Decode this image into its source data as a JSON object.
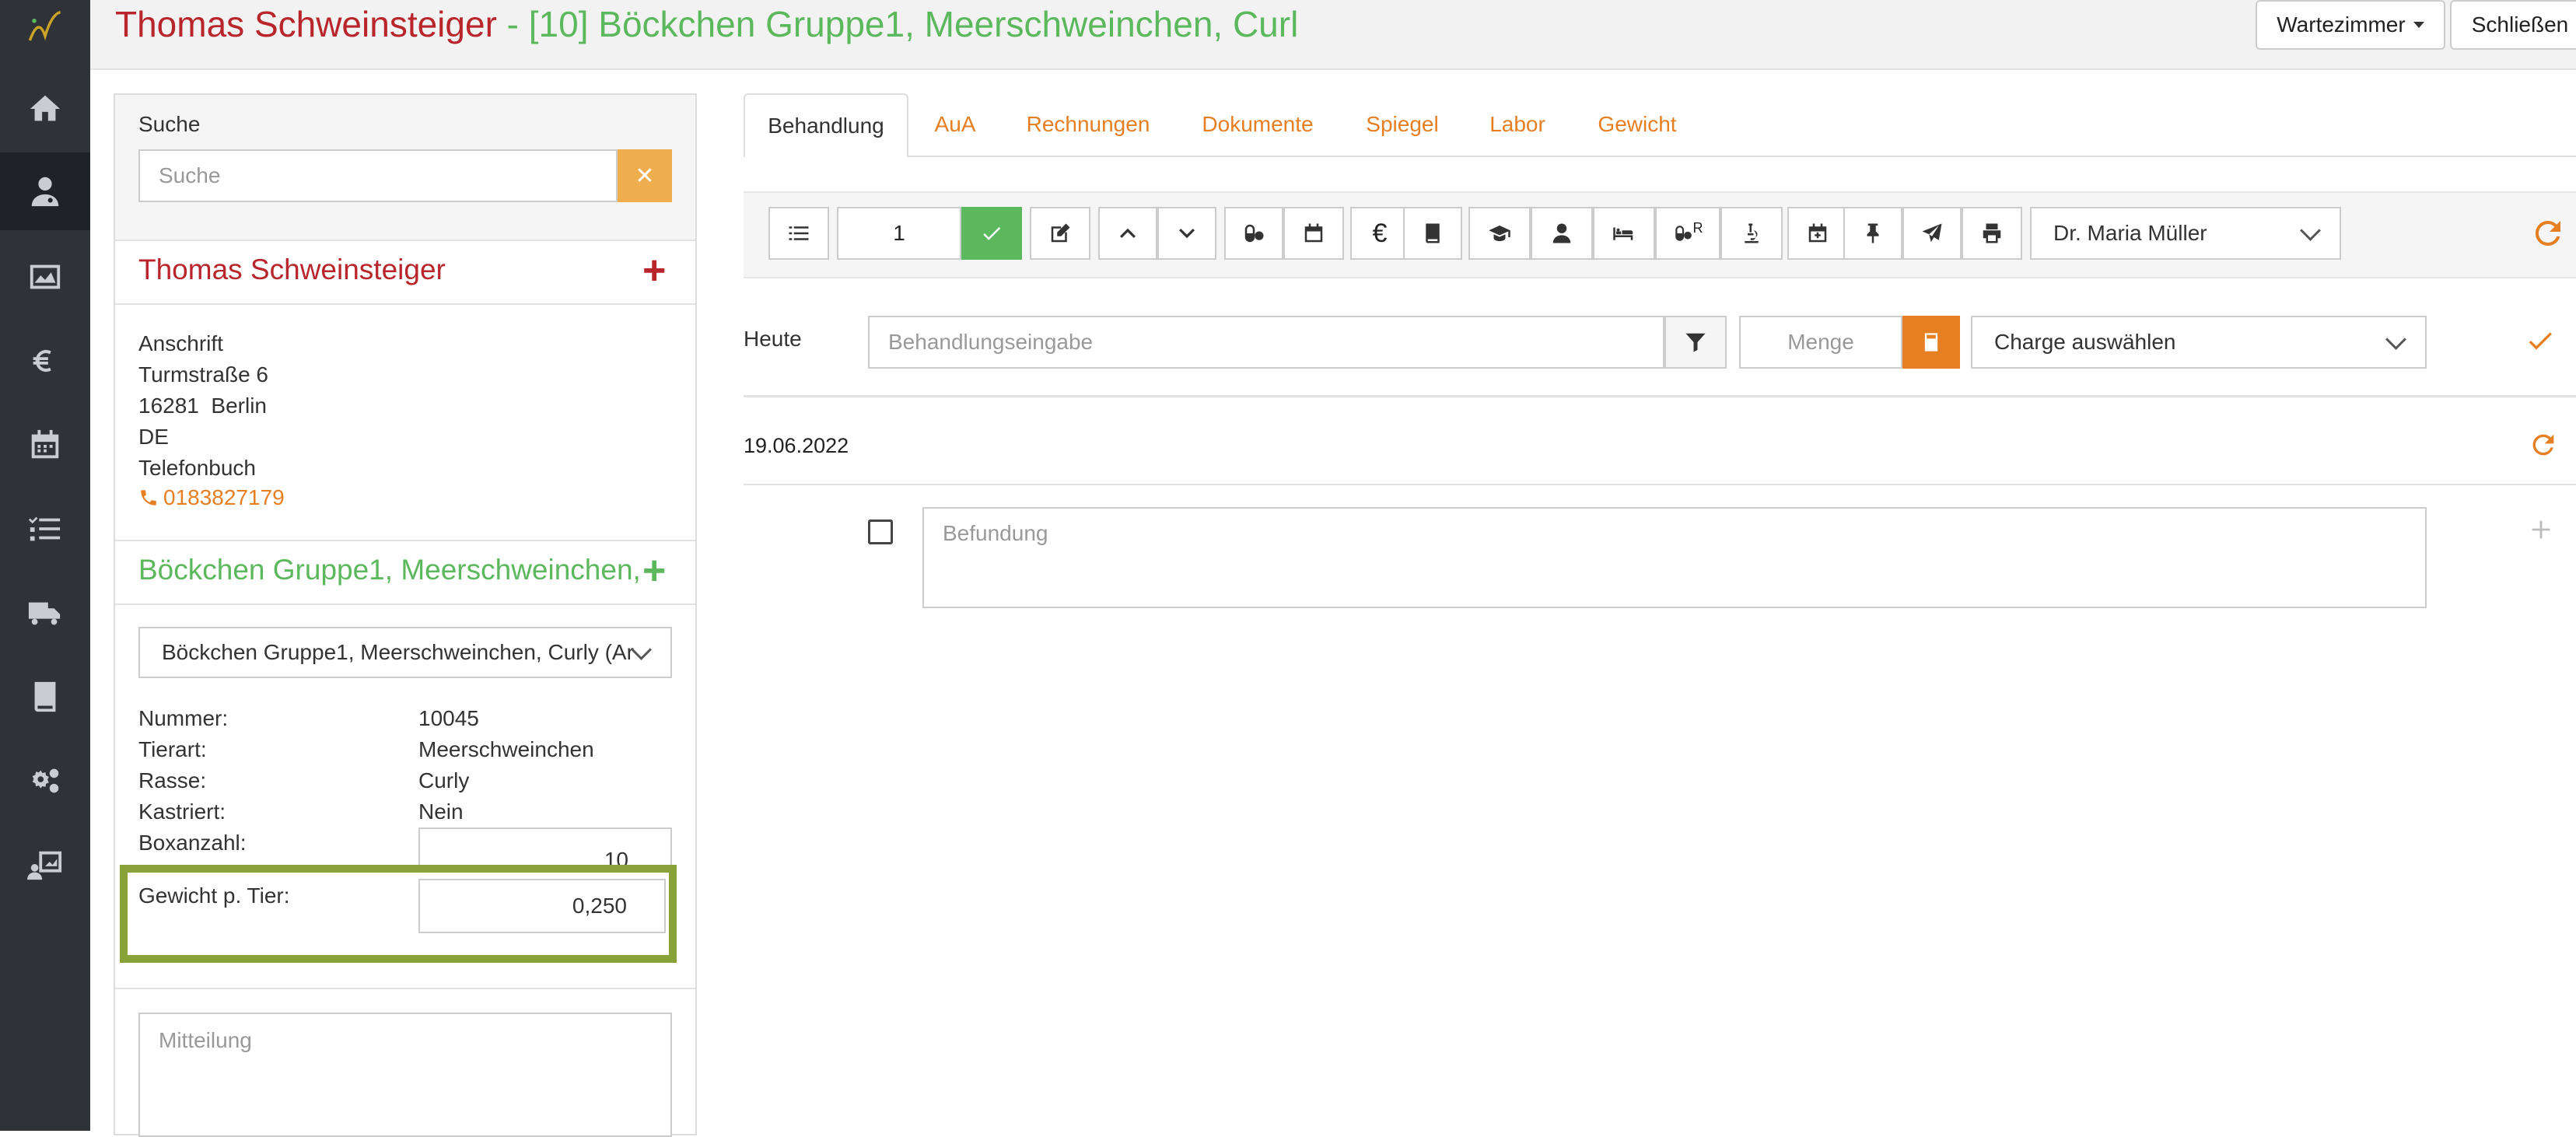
{
  "header": {
    "owner_name": "Thomas Schweinsteiger",
    "separator": " - ",
    "animal_title": "[10] Böckchen Gruppe1, Meerschweinchen, Curl",
    "waiting_room_button": "Wartezimmer",
    "close_button": "Schließen"
  },
  "search": {
    "label": "Suche",
    "placeholder": "Suche",
    "clear_symbol": "✕"
  },
  "owner": {
    "name": "Thomas Schweinsteiger",
    "add_symbol": "+",
    "address_label": "Anschrift",
    "street": "Turmstraße 6",
    "city": "16281  Berlin",
    "country": "DE",
    "phonebook_label": "Telefonbuch",
    "phone": "0183827179"
  },
  "animal": {
    "group_title": "Böckchen Gruppe1, Meerschweinchen,",
    "add_symbol": "+",
    "select_value": "Böckchen Gruppe1, Meerschweinchen, Curly (Ar",
    "fields": [
      {
        "label": "Nummer:",
        "value": "10045"
      },
      {
        "label": "Tierart:",
        "value": "Meerschweinchen"
      },
      {
        "label": "Rasse:",
        "value": "Curly"
      },
      {
        "label": "Kastriert:",
        "value": "Nein"
      }
    ],
    "box_count_label": "Boxanzahl:",
    "box_count_value": "10",
    "weight_label": "Gewicht p. Tier:",
    "weight_value": "0,250",
    "highlight_color": "#8aa23a",
    "message_placeholder": "Mitteilung"
  },
  "tabs": [
    {
      "label": "Behandlung",
      "active": true
    },
    {
      "label": "AuA"
    },
    {
      "label": "Rechnungen"
    },
    {
      "label": "Dokumente"
    },
    {
      "label": "Spiegel"
    },
    {
      "label": "Labor"
    },
    {
      "label": "Gewicht"
    }
  ],
  "toolbar": {
    "quantity_value": "1",
    "doctor_select": "Dr. Maria Müller",
    "euro_symbol": "€",
    "rx_superscript": "R"
  },
  "entry": {
    "today_label": "Heute",
    "treatment_placeholder": "Behandlungseingabe",
    "quantity_placeholder": "Menge",
    "charge_select": "Charge auswählen"
  },
  "record": {
    "date": "19.06.2022",
    "finding_placeholder": "Befundung"
  },
  "colors": {
    "accent_orange": "#e67e22",
    "success_green": "#5cb85c",
    "owner_red": "#b8262c",
    "sidebar_bg": "#2f3338"
  }
}
